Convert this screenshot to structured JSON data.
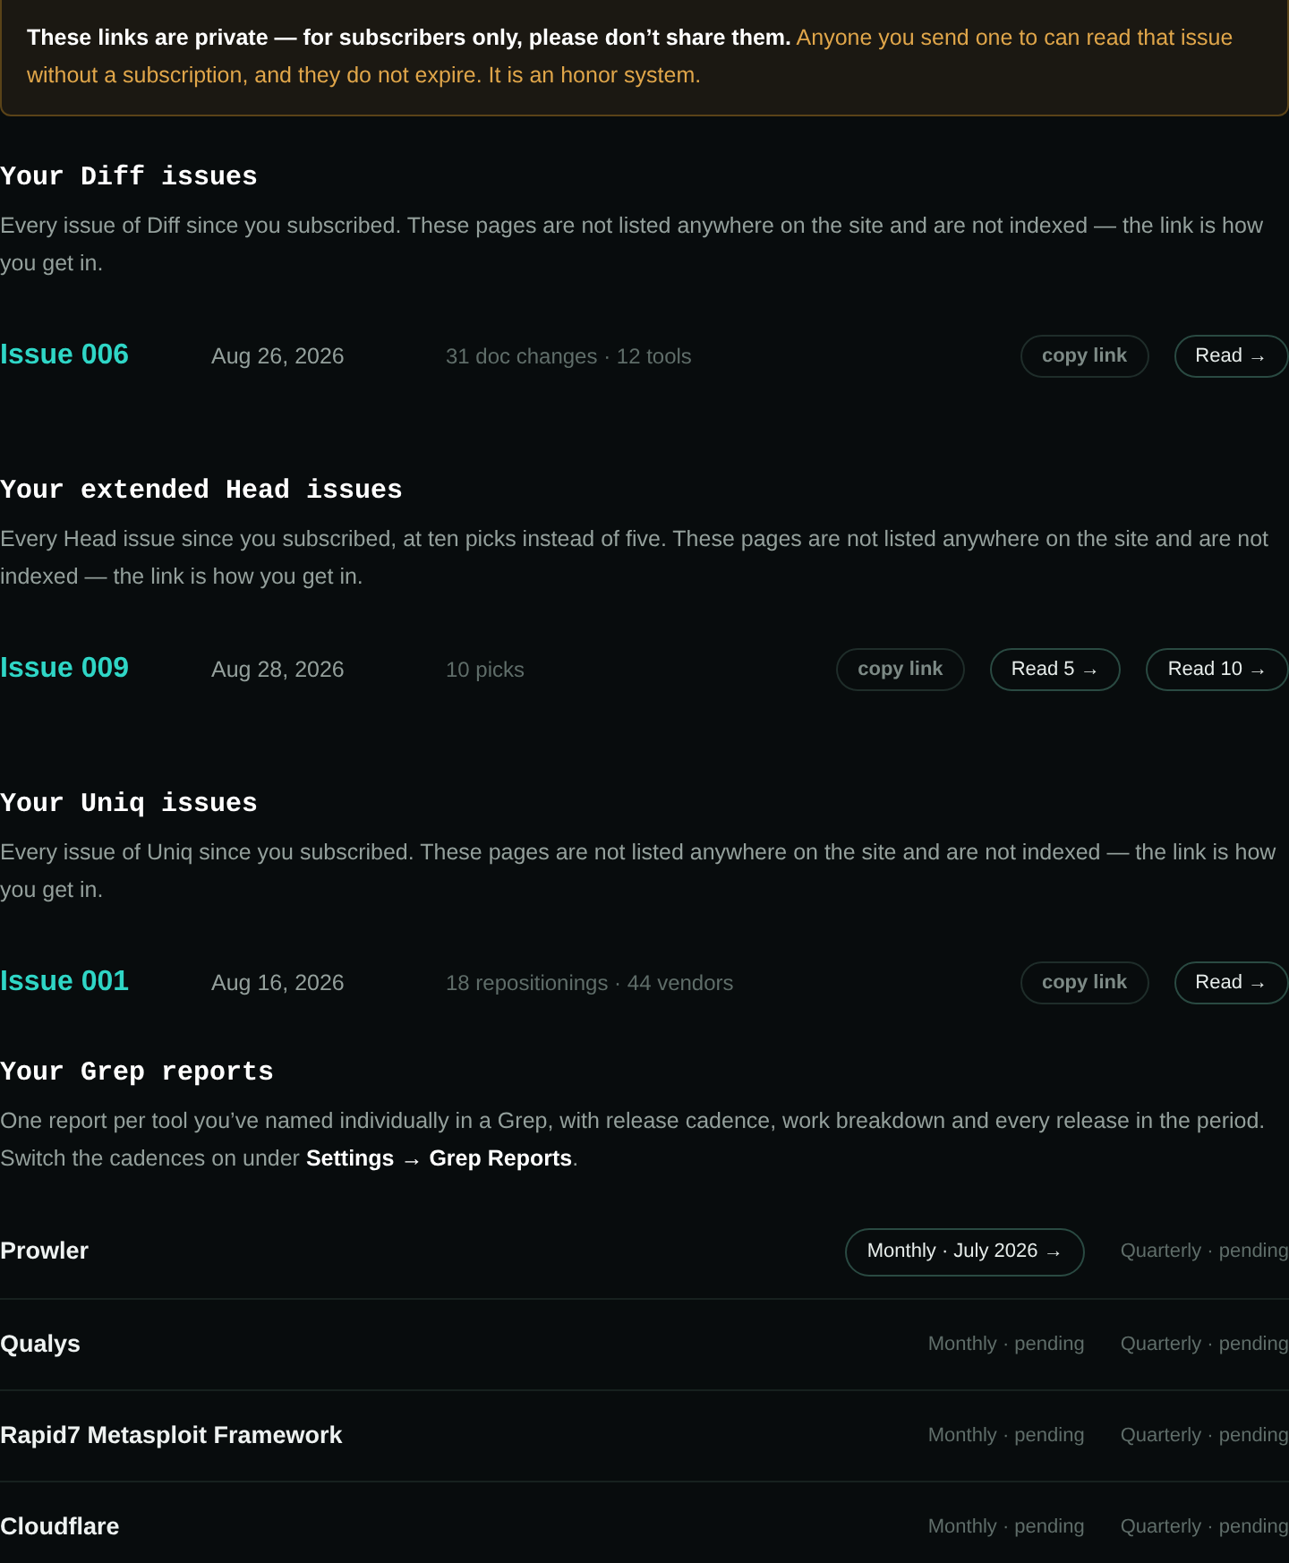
{
  "notice": {
    "text": "**These links are private — for subscribers only, please don’t share them.** Anyone you send one to can read that issue without a subscription, and they do not expire. It is an honor system."
  },
  "sections": [
    {
      "title": "Your Diff issues",
      "description": "Every issue of Diff since you subscribed. These pages are not listed anywhere on the site and are not indexed — the link is how you get in.",
      "issues": [
        {
          "label": "Issue 006",
          "date": "Aug 26, 2026",
          "meta": "31 doc changes · 12 tools",
          "actions": [
            {
              "kind": "copy",
              "label": "copy link"
            },
            {
              "kind": "read",
              "label": "Read →"
            }
          ]
        }
      ]
    },
    {
      "title": "Your extended Head issues",
      "description": "Every Head issue since you subscribed, at ten picks instead of five. These pages are not listed anywhere on the site and are not indexed — the link is how you get in.",
      "issues": [
        {
          "label": "Issue 009",
          "date": "Aug 28, 2026",
          "meta": "10 picks",
          "actions": [
            {
              "kind": "copy",
              "label": "copy link"
            },
            {
              "kind": "read",
              "label": "Read 5 →"
            },
            {
              "kind": "read",
              "label": "Read 10 →"
            }
          ]
        }
      ]
    },
    {
      "title": "Your Uniq issues",
      "description": "Every issue of Uniq since you subscribed. These pages are not listed anywhere on the site and are not indexed — the link is how you get in.",
      "issues": [
        {
          "label": "Issue 001",
          "date": "Aug 16, 2026",
          "meta": "18 repositionings · 44 vendors",
          "actions": [
            {
              "kind": "copy",
              "label": "copy link"
            },
            {
              "kind": "read",
              "label": "Read →"
            }
          ]
        }
      ]
    }
  ],
  "grep": {
    "title": "Your Grep reports",
    "description": "One report per tool you’ve named individually in a Grep, with release cadence, work breakdown and every release in the period. Switch the cadences on under **Settings → Grep Reports**.",
    "reports": [
      {
        "name": "Prowler",
        "cells": [
          {
            "kind": "link",
            "label": "Monthly · July 2026 →"
          },
          {
            "kind": "pending",
            "label": "Quarterly · pending"
          }
        ]
      },
      {
        "name": "Qualys",
        "cells": [
          {
            "kind": "pending",
            "label": "Monthly · pending"
          },
          {
            "kind": "pending",
            "label": "Quarterly · pending"
          }
        ]
      },
      {
        "name": "Rapid7 Metasploit Framework",
        "cells": [
          {
            "kind": "pending",
            "label": "Monthly · pending"
          },
          {
            "kind": "pending",
            "label": "Quarterly · pending"
          }
        ]
      },
      {
        "name": "Cloudflare",
        "cells": [
          {
            "kind": "pending",
            "label": "Monthly · pending"
          },
          {
            "kind": "pending",
            "label": "Quarterly · pending"
          }
        ]
      }
    ]
  }
}
